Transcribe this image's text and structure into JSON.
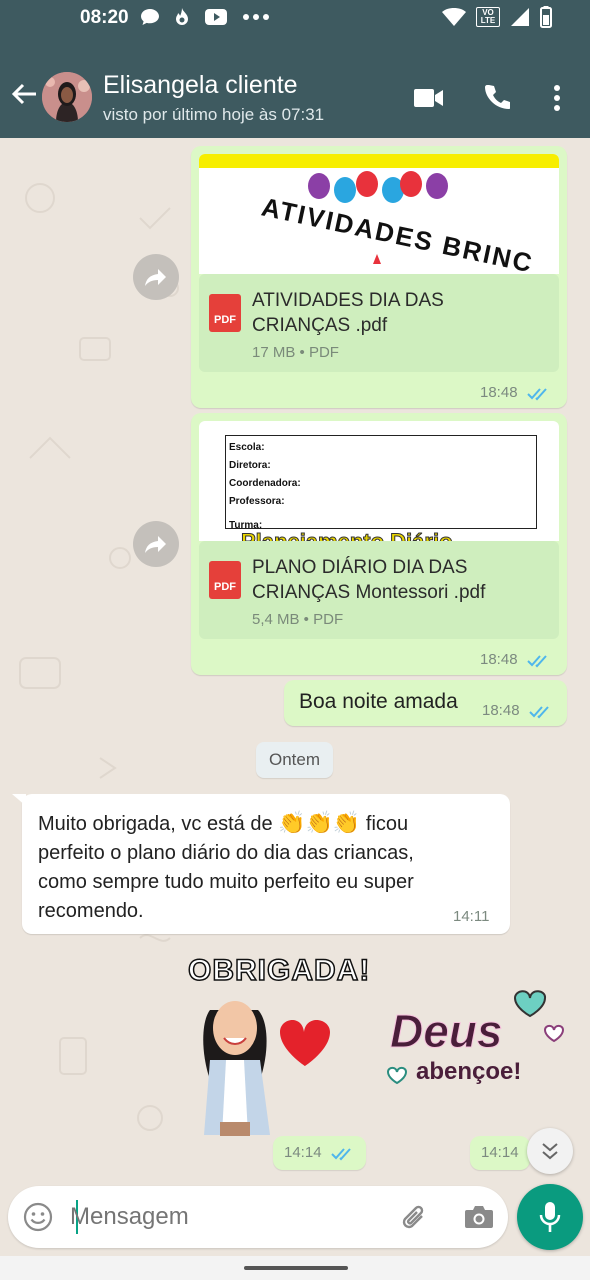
{
  "status_bar": {
    "time": "08:20",
    "network_label": "VO LTE"
  },
  "header": {
    "contact_name": "Elisangela cliente",
    "last_seen": "visto por último hoje às 07:31",
    "icons": [
      "back-arrow-icon",
      "video-call-icon",
      "phone-icon",
      "more-vert-icon"
    ]
  },
  "messages": {
    "doc1": {
      "preview_title": "ATIVIDADES BRINC",
      "file_name_line1": "ATIVIDADES DIA DAS",
      "file_name_line2": "CRIANÇAS .pdf",
      "meta": "17 MB • PDF",
      "time": "18:48",
      "pdf_label": "PDF"
    },
    "doc2": {
      "form_fields": [
        "Escola:",
        "Diretora:",
        "Coordenadora:",
        "Professora:",
        "Turma:"
      ],
      "preview_footer": "Planejamento Diário",
      "file_name_line1": "PLANO DIÁRIO DIA DAS",
      "file_name_line2": "CRIANÇAS Montessori .pdf",
      "meta": "5,4 MB • PDF",
      "time": "18:48",
      "pdf_label": "PDF"
    },
    "text_out": {
      "text": "Boa noite amada",
      "time": "18:48"
    },
    "date_divider": "Ontem",
    "text_in": {
      "line1_before": "Muito obrigada, vc  está  de ",
      "emoji": "👏👏👏",
      "line1_after": " ficou",
      "line2": "perfeito  o plano diário  do dia das criancas,",
      "line3": "como sempre tudo muito perfeito eu super",
      "line4": "recomendo.",
      "time": "14:11"
    },
    "sticker1": {
      "text": "OBRIGADA!",
      "time": "14:14"
    },
    "sticker2": {
      "line1": "Deus",
      "line2": "abençoe!",
      "time": "14:14"
    }
  },
  "composer": {
    "placeholder": "Mensagem"
  },
  "colors": {
    "header": "#3e5a60",
    "outgoing_bubble": "#dcf8c6",
    "incoming_bubble": "#ffffff",
    "chat_background": "#ece5dd",
    "read_ticks": "#4fb6ec",
    "mic_button": "#0a9b7f",
    "pdf_red": "#e5403a"
  }
}
